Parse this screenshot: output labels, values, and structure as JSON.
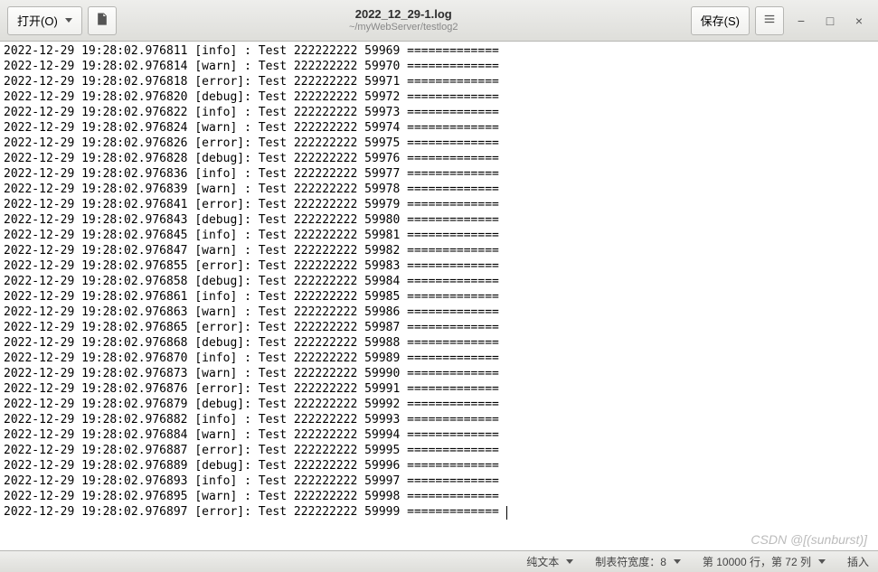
{
  "toolbar": {
    "open_label": "打开(O)",
    "recent_icon": "recent-icon",
    "save_label": "保存(S)",
    "hamburger_icon": "menu-icon"
  },
  "title": {
    "main": "2022_12_29-1.log",
    "sub": "~/myWebServer/testlog2"
  },
  "window_controls": {
    "minimize": "−",
    "maximize": "□",
    "close": "×"
  },
  "log_lines": [
    {
      "ts": "2022-12-29 19:28:02.976811",
      "level": "[info] ",
      "msg": "Test 222222222 59969 ============="
    },
    {
      "ts": "2022-12-29 19:28:02.976814",
      "level": "[warn] ",
      "msg": "Test 222222222 59970 ============="
    },
    {
      "ts": "2022-12-29 19:28:02.976818",
      "level": "[error]",
      "msg": "Test 222222222 59971 ============="
    },
    {
      "ts": "2022-12-29 19:28:02.976820",
      "level": "[debug]",
      "msg": "Test 222222222 59972 ============="
    },
    {
      "ts": "2022-12-29 19:28:02.976822",
      "level": "[info] ",
      "msg": "Test 222222222 59973 ============="
    },
    {
      "ts": "2022-12-29 19:28:02.976824",
      "level": "[warn] ",
      "msg": "Test 222222222 59974 ============="
    },
    {
      "ts": "2022-12-29 19:28:02.976826",
      "level": "[error]",
      "msg": "Test 222222222 59975 ============="
    },
    {
      "ts": "2022-12-29 19:28:02.976828",
      "level": "[debug]",
      "msg": "Test 222222222 59976 ============="
    },
    {
      "ts": "2022-12-29 19:28:02.976836",
      "level": "[info] ",
      "msg": "Test 222222222 59977 ============="
    },
    {
      "ts": "2022-12-29 19:28:02.976839",
      "level": "[warn] ",
      "msg": "Test 222222222 59978 ============="
    },
    {
      "ts": "2022-12-29 19:28:02.976841",
      "level": "[error]",
      "msg": "Test 222222222 59979 ============="
    },
    {
      "ts": "2022-12-29 19:28:02.976843",
      "level": "[debug]",
      "msg": "Test 222222222 59980 ============="
    },
    {
      "ts": "2022-12-29 19:28:02.976845",
      "level": "[info] ",
      "msg": "Test 222222222 59981 ============="
    },
    {
      "ts": "2022-12-29 19:28:02.976847",
      "level": "[warn] ",
      "msg": "Test 222222222 59982 ============="
    },
    {
      "ts": "2022-12-29 19:28:02.976855",
      "level": "[error]",
      "msg": "Test 222222222 59983 ============="
    },
    {
      "ts": "2022-12-29 19:28:02.976858",
      "level": "[debug]",
      "msg": "Test 222222222 59984 ============="
    },
    {
      "ts": "2022-12-29 19:28:02.976861",
      "level": "[info] ",
      "msg": "Test 222222222 59985 ============="
    },
    {
      "ts": "2022-12-29 19:28:02.976863",
      "level": "[warn] ",
      "msg": "Test 222222222 59986 ============="
    },
    {
      "ts": "2022-12-29 19:28:02.976865",
      "level": "[error]",
      "msg": "Test 222222222 59987 ============="
    },
    {
      "ts": "2022-12-29 19:28:02.976868",
      "level": "[debug]",
      "msg": "Test 222222222 59988 ============="
    },
    {
      "ts": "2022-12-29 19:28:02.976870",
      "level": "[info] ",
      "msg": "Test 222222222 59989 ============="
    },
    {
      "ts": "2022-12-29 19:28:02.976873",
      "level": "[warn] ",
      "msg": "Test 222222222 59990 ============="
    },
    {
      "ts": "2022-12-29 19:28:02.976876",
      "level": "[error]",
      "msg": "Test 222222222 59991 ============="
    },
    {
      "ts": "2022-12-29 19:28:02.976879",
      "level": "[debug]",
      "msg": "Test 222222222 59992 ============="
    },
    {
      "ts": "2022-12-29 19:28:02.976882",
      "level": "[info] ",
      "msg": "Test 222222222 59993 ============="
    },
    {
      "ts": "2022-12-29 19:28:02.976884",
      "level": "[warn] ",
      "msg": "Test 222222222 59994 ============="
    },
    {
      "ts": "2022-12-29 19:28:02.976887",
      "level": "[error]",
      "msg": "Test 222222222 59995 ============="
    },
    {
      "ts": "2022-12-29 19:28:02.976889",
      "level": "[debug]",
      "msg": "Test 222222222 59996 ============="
    },
    {
      "ts": "2022-12-29 19:28:02.976893",
      "level": "[info] ",
      "msg": "Test 222222222 59997 ============="
    },
    {
      "ts": "2022-12-29 19:28:02.976895",
      "level": "[warn] ",
      "msg": "Test 222222222 59998 ============="
    },
    {
      "ts": "2022-12-29 19:28:02.976897",
      "level": "[error]",
      "msg": "Test 222222222 59999 ============="
    }
  ],
  "statusbar": {
    "syntax": "纯文本",
    "tab_width": "制表符宽度：8",
    "position": "第 10000 行，第 72 列",
    "mode": "插入"
  },
  "watermark": "CSDN @[(sunburst)]"
}
